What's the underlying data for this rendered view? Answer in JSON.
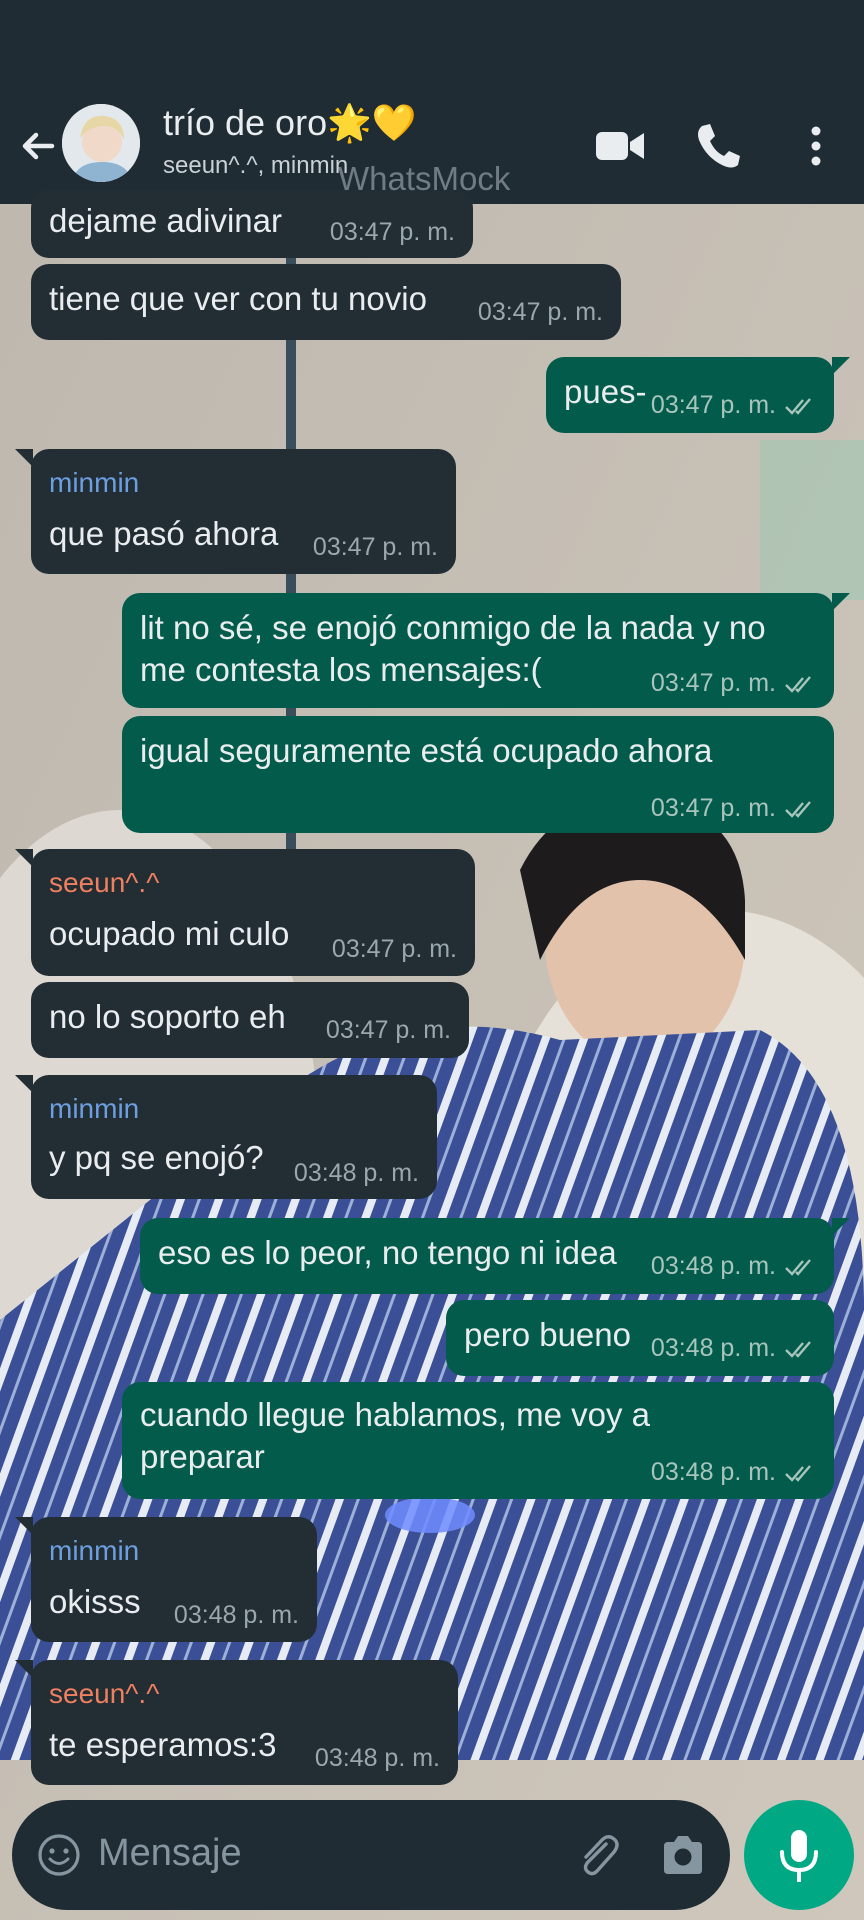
{
  "header": {
    "title": "trío de oro🌟💛",
    "subtitle": "seeun^.^, minmin"
  },
  "watermark": "WhatsMock",
  "messages": [
    {
      "dir": "in",
      "sender": "",
      "lines": [
        "dejame adivinar"
      ],
      "time": "03:47 p. m."
    },
    {
      "dir": "in",
      "sender": "",
      "lines": [
        "tiene que ver con tu novio"
      ],
      "time": "03:47 p. m."
    },
    {
      "dir": "out",
      "lines": [
        "pues-"
      ],
      "time": "03:47 p. m.",
      "status": "read"
    },
    {
      "dir": "in",
      "sender": "minmin",
      "lines": [
        "que pasó ahora"
      ],
      "time": "03:47 p. m."
    },
    {
      "dir": "out",
      "lines": [
        "lit no sé, se enojó conmigo de la nada y no",
        "me contesta los mensajes:("
      ],
      "time": "03:47 p. m.",
      "status": "read"
    },
    {
      "dir": "out",
      "lines": [
        "igual seguramente está ocupado ahora"
      ],
      "time": "03:47 p. m.",
      "status": "read"
    },
    {
      "dir": "in",
      "sender": "seeun^.^",
      "lines": [
        "ocupado mi culo"
      ],
      "time": "03:47 p. m."
    },
    {
      "dir": "in",
      "sender": "",
      "lines": [
        "no lo soporto eh"
      ],
      "time": "03:47 p. m."
    },
    {
      "dir": "in",
      "sender": "minmin",
      "lines": [
        "y pq se enojó?"
      ],
      "time": "03:48 p. m."
    },
    {
      "dir": "out",
      "lines": [
        "eso es lo peor, no tengo ni idea"
      ],
      "time": "03:48 p. m.",
      "status": "read"
    },
    {
      "dir": "out",
      "lines": [
        "pero bueno"
      ],
      "time": "03:48 p. m.",
      "status": "read"
    },
    {
      "dir": "out",
      "lines": [
        "cuando llegue hablamos, me voy a",
        "preparar"
      ],
      "time": "03:48 p. m.",
      "status": "read"
    },
    {
      "dir": "in",
      "sender": "minmin",
      "lines": [
        "okisss"
      ],
      "time": "03:48 p. m."
    },
    {
      "dir": "in",
      "sender": "seeun^.^",
      "lines": [
        "te esperamos:3"
      ],
      "time": "03:48 p. m."
    }
  ],
  "input": {
    "placeholder": "Mensaje"
  },
  "colors": {
    "header_bg": "#1f2c34",
    "incoming_bubble": "#222d34",
    "outgoing_bubble": "#035c4b",
    "sender_minmin": "#6d9fe0",
    "sender_seeun": "#ee7f5f",
    "accent": "#00a884"
  },
  "icons": [
    "back-arrow-icon",
    "avatar",
    "video-call-icon",
    "phone-icon",
    "more-options-icon",
    "emoji-icon",
    "attach-icon",
    "camera-icon",
    "mic-icon",
    "double-check-icon"
  ]
}
